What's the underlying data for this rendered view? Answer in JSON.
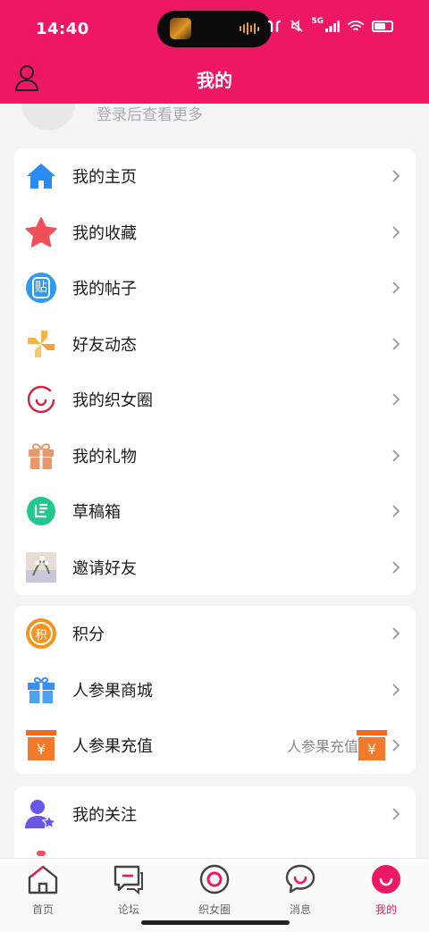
{
  "status_bar": {
    "time": "14:40",
    "network": "5G"
  },
  "header": {
    "title": "我的"
  },
  "profile": {
    "login_hint": "登录后查看更多"
  },
  "menu_group_1": [
    {
      "label": "我的主页",
      "icon": "home-icon"
    },
    {
      "label": "我的收藏",
      "icon": "star-icon"
    },
    {
      "label": "我的帖子",
      "icon": "post-icon",
      "icon_text": "贴"
    },
    {
      "label": "好友动态",
      "icon": "pinwheel-icon"
    },
    {
      "label": "我的织女圈",
      "icon": "circle-icon"
    },
    {
      "label": "我的礼物",
      "icon": "gift-icon"
    },
    {
      "label": "草稿箱",
      "icon": "draft-icon"
    },
    {
      "label": "邀请好友",
      "icon": "invite-image"
    }
  ],
  "menu_group_2": [
    {
      "label": "积分",
      "icon": "points-icon",
      "icon_text": "积"
    },
    {
      "label": "人参果商城",
      "icon": "shop-gift-icon"
    },
    {
      "label": "人参果充值",
      "icon": "recharge-icon",
      "extra": "人参果充值",
      "icon_text": "¥"
    }
  ],
  "menu_group_3": [
    {
      "label": "我的关注",
      "icon": "follow-icon"
    }
  ],
  "tabbar": {
    "items": [
      {
        "label": "首页",
        "icon": "home-tab-icon"
      },
      {
        "label": "论坛",
        "icon": "forum-tab-icon"
      },
      {
        "label": "织女圈",
        "icon": "circle-tab-icon"
      },
      {
        "label": "消息",
        "icon": "message-tab-icon"
      },
      {
        "label": "我的",
        "icon": "me-tab-icon",
        "active": true
      }
    ]
  },
  "colors": {
    "brand": "#ee1764",
    "page_bg": "#f4f4f6",
    "card_bg": "#ffffff"
  }
}
